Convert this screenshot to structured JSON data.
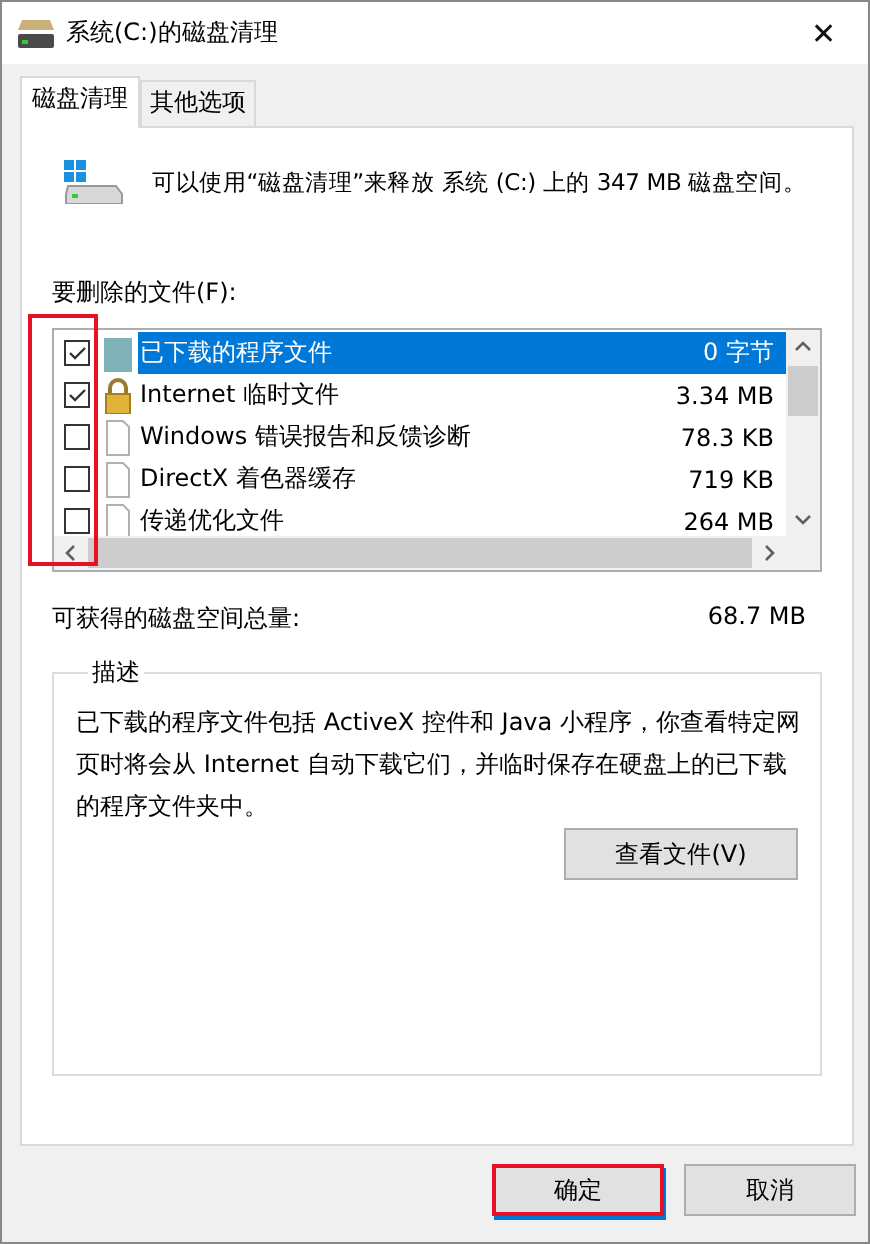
{
  "window": {
    "title": "系统(C:)的磁盘清理",
    "close": "✕"
  },
  "tabs": [
    {
      "label": "磁盘清理",
      "selected": true
    },
    {
      "label": "其他选项",
      "selected": false
    }
  ],
  "intro": "可以使用“磁盘清理”来释放 系统 (C:) 上的 347 MB 磁盘空间。",
  "files_label": "要删除的文件(F):",
  "files": {
    "highlighted": true,
    "rows": [
      {
        "kind": "program",
        "name": "已下载的程序文件",
        "size": "0 字节",
        "checked": true,
        "selected": true
      },
      {
        "kind": "locked",
        "name": "Internet 临时文件",
        "size": "3.34 MB",
        "checked": true,
        "selected": false
      },
      {
        "kind": "file",
        "name": "Windows 错误报告和反馈诊断",
        "size": "78.3 KB",
        "checked": false,
        "selected": false
      },
      {
        "kind": "file",
        "name": "DirectX 着色器缓存",
        "size": "719 KB",
        "checked": false,
        "selected": false
      },
      {
        "kind": "file",
        "name": "传递优化文件",
        "size": "264 MB",
        "checked": false,
        "selected": false
      }
    ]
  },
  "total": {
    "label": "可获得的磁盘空间总量:",
    "value": "68.7 MB"
  },
  "description": {
    "legend": "描述",
    "text": "已下载的程序文件包括 ActiveX 控件和 Java 小程序，你查看特定网页时将会从 Internet 自动下载它们，并临时保存在硬盘上的已下载的程序文件夹中。",
    "button": "查看文件(V)"
  },
  "buttons": [
    {
      "label": "确定",
      "highlighted": true
    },
    {
      "label": "取消",
      "highlighted": false
    }
  ]
}
